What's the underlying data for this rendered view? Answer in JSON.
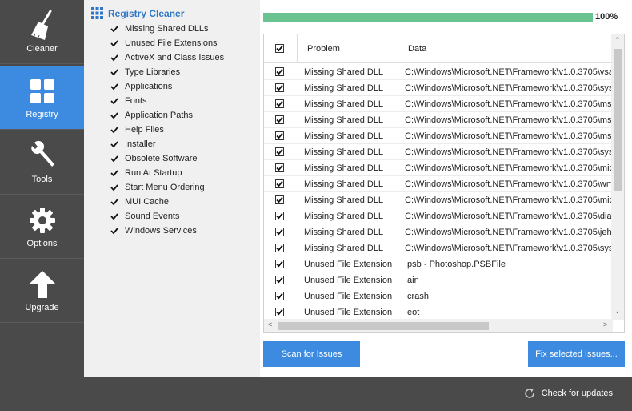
{
  "sidebar": {
    "items": [
      {
        "label": "Cleaner",
        "icon": "broom-icon"
      },
      {
        "label": "Registry",
        "icon": "grid-icon"
      },
      {
        "label": "Tools",
        "icon": "wrench-icon"
      },
      {
        "label": "Options",
        "icon": "gear-icon"
      },
      {
        "label": "Upgrade",
        "icon": "up-arrow-icon"
      }
    ],
    "active": "Registry"
  },
  "options_panel": {
    "title": "Registry Cleaner",
    "items": [
      "Missing Shared DLLs",
      "Unused File Extensions",
      "ActiveX and Class Issues",
      "Type Libraries",
      "Applications",
      "Fonts",
      "Application Paths",
      "Help Files",
      "Installer",
      "Obsolete Software",
      "Run At Startup",
      "Start Menu Ordering",
      "MUI Cache",
      "Sound Events",
      "Windows Services"
    ]
  },
  "progress": {
    "value": 1.0,
    "label": "100%"
  },
  "table": {
    "headers": {
      "problem": "Problem",
      "data": "Data"
    },
    "rows": [
      {
        "problem": "Missing Shared DLL",
        "data": "C:\\Windows\\Microsoft.NET\\Framework\\v1.0.3705\\vsa"
      },
      {
        "problem": "Missing Shared DLL",
        "data": "C:\\Windows\\Microsoft.NET\\Framework\\v1.0.3705\\sys"
      },
      {
        "problem": "Missing Shared DLL",
        "data": "C:\\Windows\\Microsoft.NET\\Framework\\v1.0.3705\\ms"
      },
      {
        "problem": "Missing Shared DLL",
        "data": "C:\\Windows\\Microsoft.NET\\Framework\\v1.0.3705\\ms"
      },
      {
        "problem": "Missing Shared DLL",
        "data": "C:\\Windows\\Microsoft.NET\\Framework\\v1.0.3705\\ms"
      },
      {
        "problem": "Missing Shared DLL",
        "data": "C:\\Windows\\Microsoft.NET\\Framework\\v1.0.3705\\sys"
      },
      {
        "problem": "Missing Shared DLL",
        "data": "C:\\Windows\\Microsoft.NET\\Framework\\v1.0.3705\\mic"
      },
      {
        "problem": "Missing Shared DLL",
        "data": "C:\\Windows\\Microsoft.NET\\Framework\\v1.0.3705\\wm"
      },
      {
        "problem": "Missing Shared DLL",
        "data": "C:\\Windows\\Microsoft.NET\\Framework\\v1.0.3705\\mic"
      },
      {
        "problem": "Missing Shared DLL",
        "data": "C:\\Windows\\Microsoft.NET\\Framework\\v1.0.3705\\dia"
      },
      {
        "problem": "Missing Shared DLL",
        "data": "C:\\Windows\\Microsoft.NET\\Framework\\v1.0.3705\\jeh"
      },
      {
        "problem": "Missing Shared DLL",
        "data": "C:\\Windows\\Microsoft.NET\\Framework\\v1.0.3705\\sys"
      },
      {
        "problem": "Unused File Extension",
        "data": ".psb - Photoshop.PSBFile"
      },
      {
        "problem": "Unused File Extension",
        "data": ".ain"
      },
      {
        "problem": "Unused File Extension",
        "data": ".crash"
      },
      {
        "problem": "Unused File Extension",
        "data": ".eot"
      }
    ]
  },
  "buttons": {
    "scan": "Scan for Issues",
    "fix": "Fix selected Issues..."
  },
  "footer": {
    "update_link": "Check for updates"
  },
  "colors": {
    "accent": "#3d8be0",
    "progress": "#6cc392",
    "sidebar": "#4a4a4a",
    "title": "#2e76c7"
  }
}
